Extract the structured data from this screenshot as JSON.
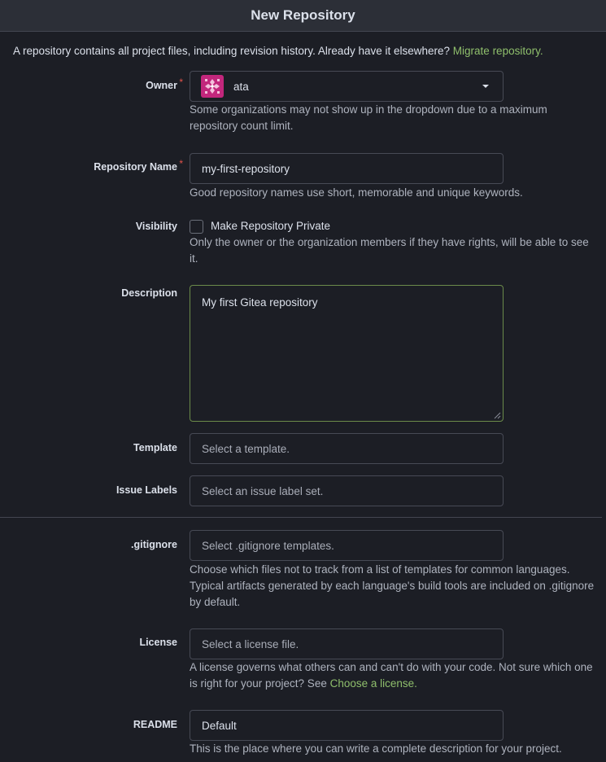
{
  "header": {
    "title": "New Repository"
  },
  "intro": {
    "text": "A repository contains all project files, including revision history. Already have it elsewhere?",
    "link": "Migrate repository."
  },
  "owner": {
    "label": "Owner",
    "required_mark": "*",
    "value": "ata",
    "help": "Some organizations may not show up in the dropdown due to a maximum repository count limit."
  },
  "repo_name": {
    "label": "Repository Name",
    "required_mark": "*",
    "value": "my-first-repository",
    "help": "Good repository names use short, memorable and unique keywords."
  },
  "visibility": {
    "label": "Visibility",
    "checkbox_label": "Make Repository Private",
    "checked": false,
    "help": "Only the owner or the organization members if they have rights, will be able to see it."
  },
  "description": {
    "label": "Description",
    "value": "My first Gitea repository"
  },
  "template": {
    "label": "Template",
    "placeholder": "Select a template."
  },
  "issue_labels": {
    "label": "Issue Labels",
    "placeholder": "Select an issue label set."
  },
  "gitignore": {
    "label": ".gitignore",
    "placeholder": "Select .gitignore templates.",
    "help": "Choose which files not to track from a list of templates for common languages. Typical artifacts generated by each language's build tools are included on .gitignore by default."
  },
  "license": {
    "label": "License",
    "placeholder": "Select a license file.",
    "help": "A license governs what others can and can't do with your code. Not sure which one is right for your project? See",
    "help_link": "Choose a license."
  },
  "readme": {
    "label": "README",
    "value": "Default",
    "help": "This is the place where you can write a complete description for your project."
  },
  "colors": {
    "background": "#1c1e25",
    "header": "#2c2f37",
    "accent_link": "#8fbf6c",
    "required": "#e5534b",
    "avatar": "#c2277c"
  }
}
